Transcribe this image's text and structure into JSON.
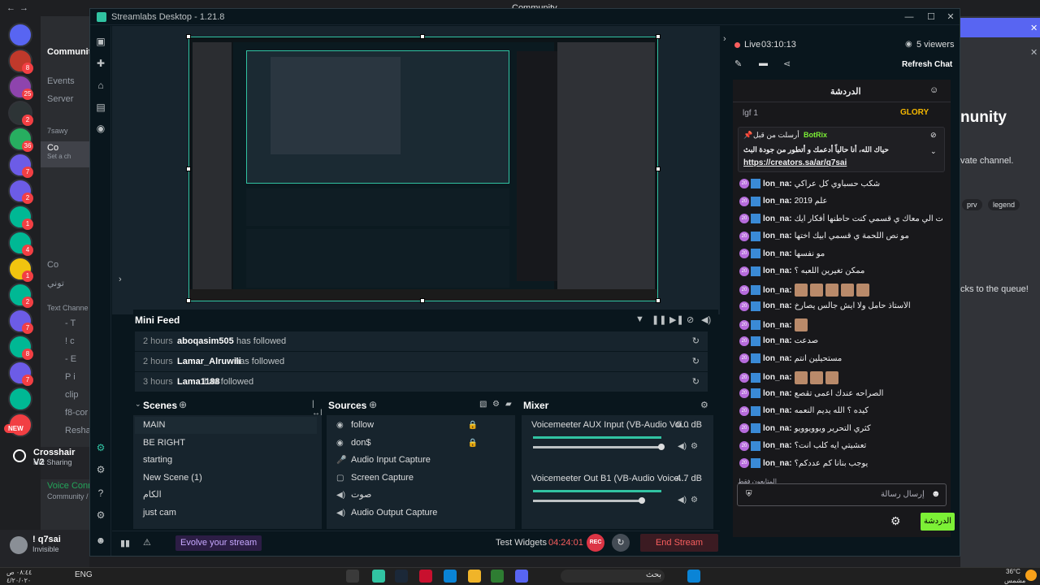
{
  "window": {
    "title": "Streamlabs Desktop - 1.21.8"
  },
  "discord": {
    "top_title": "Community",
    "header": "Communit",
    "events": "Events",
    "server": "Server",
    "category": "7sawy",
    "channel_active": "Co",
    "channel_sub": "Set a ch",
    "channel_2": "Co",
    "channel_3": "توني",
    "text_channels": "Text Channe",
    "text_items": [
      "- T",
      "! c",
      "- E",
      "P i",
      "clip",
      "f8-cor",
      "Reshac"
    ],
    "user_name": "Crosshair V2",
    "user_status": "Not Sharing",
    "voice_label": "Voice Connect",
    "voice_sub": "Community /",
    "account_name": "! q7sai",
    "account_status": "Invisible",
    "right_heading": "nunity",
    "right_text_1": "vate channel.",
    "right_tag_1": "prv",
    "right_tag_2": "legend",
    "right_text_2": "cks to the queue!",
    "new_badge": "NEW",
    "server_badges": [
      "8",
      "25",
      "2",
      "36",
      "7",
      "2",
      "1",
      "4",
      "1",
      "2",
      "7",
      "8",
      "7"
    ]
  },
  "sidenav": {
    "icons": [
      "studio-icon",
      "themes-icon",
      "store-icon",
      "layout-icon",
      "record-icon",
      "highlighter-icon",
      "settings-icon",
      "help-icon",
      "profile-icon"
    ]
  },
  "minifeed": {
    "title": "Mini Feed",
    "events": [
      {
        "time": "2 hours",
        "name": "aboqasim505",
        "action": "has followed"
      },
      {
        "time": "2 hours",
        "name": "Lamar_Alruwili",
        "action": "has followed"
      },
      {
        "time": "3 hours",
        "name": "Lama1188",
        "action": "has followed"
      }
    ]
  },
  "scenes": {
    "title": "Scenes",
    "items": [
      "MAIN",
      "BE RIGHT",
      "starting",
      "New Scene (1)",
      "الكام",
      "just cam"
    ],
    "selected": "MAIN"
  },
  "sources": {
    "title": "Sources",
    "items": [
      {
        "label": "follow",
        "locked": true
      },
      {
        "label": "don$",
        "locked": true
      },
      {
        "label": "Audio Input Capture",
        "locked": false
      },
      {
        "label": "Screen Capture",
        "locked": false
      },
      {
        "label": "صوت",
        "locked": false
      },
      {
        "label": "Audio Output Capture",
        "locked": false
      }
    ]
  },
  "mixer": {
    "title": "Mixer",
    "channels": [
      {
        "name": "Voicemeeter AUX Input (VB-Audio Voi...",
        "db": "0.0 dB",
        "level": 1.0
      },
      {
        "name": "Voicemeeter Out B1 (VB-Audio Voice...",
        "db": "-4.7 dB",
        "level": 0.85
      }
    ]
  },
  "footer": {
    "evolve": "Evolve your stream",
    "test_widgets": "Test Widgets",
    "timer": "04:24:01",
    "rec": "REC",
    "end_stream": "End Stream"
  },
  "live": {
    "status": "Live",
    "time": "03:10:13",
    "viewers": "5 viewers",
    "refresh": "Refresh Chat"
  },
  "chat": {
    "header": "الدردشة",
    "top_user": "GLORY",
    "top_prefix": "lgf 1",
    "pinned_label": "أرسلت من قبل",
    "pinned_user": "BotRix",
    "pinned_text": "حياك الله، أنا حالياً أدعمك و أتطور من جودة البث",
    "pinned_link": "https://creators.sa/ar/q7sai",
    "messages": [
      {
        "user": "lon_na:",
        "text": "شكب حسباوي كل عراكي",
        "emotes": 0
      },
      {
        "user": "lon_na:",
        "text": "علم 2019",
        "emotes": 0
      },
      {
        "user": "lon_na:",
        "text": "البنت الي معاك ي قسمي كنت حاطنها أفكار ايك",
        "emotes": 0
      },
      {
        "user": "lon_na:",
        "text": "مو نص اللحمة ي قسمي ابيك اختها",
        "emotes": 0
      },
      {
        "user": "lon_na:",
        "text": "مو نفسها",
        "emotes": 0
      },
      {
        "user": "lon_na:",
        "text": "ممكن تغيرين اللعبه ؟",
        "emotes": 0
      },
      {
        "user": "lon_na:",
        "text": "",
        "emotes": 5
      },
      {
        "user": "lon_na:",
        "text": "الأستاذ حامل ولا ايش جالس يصارخ",
        "emotes": 0
      },
      {
        "user": "lon_na:",
        "text": "",
        "emotes": 1
      },
      {
        "user": "lon_na:",
        "text": "صدعت",
        "emotes": 0
      },
      {
        "user": "lon_na:",
        "text": "مستحيلين انتم",
        "emotes": 0
      },
      {
        "user": "lon_na:",
        "text": "",
        "emotes": 3
      },
      {
        "user": "lon_na:",
        "text": "الصراحه عندك اعمى تقصع",
        "emotes": 0
      },
      {
        "user": "lon_na:",
        "text": "كيده ؟ الله يديم النعمه",
        "emotes": 0
      },
      {
        "user": "lon_na:",
        "text": "كثري التحرير ويوويوويو",
        "emotes": 0
      },
      {
        "user": "lon_na:",
        "text": "تعشيتي ايه كلب انت؟",
        "emotes": 0
      },
      {
        "user": "lon_na:",
        "text": "يوجب بنانا كم عددكم؟",
        "emotes": 0
      }
    ],
    "followers_only": "المتابعون فقط",
    "input_placeholder": "إرسال رسالة",
    "send": "الدردشة"
  },
  "taskbar": {
    "time": "٠٨:٤٤ ص",
    "date": "٤/٢٠/٠٢٠",
    "lang": "ENG",
    "search": "بحث",
    "weather_temp": "36°C",
    "weather_desc": "مشمس"
  },
  "colors": {
    "accent": "#31c3a2",
    "live": "#f85e5e",
    "chat_send": "#7cf036",
    "discord_brand": "#5865f2"
  }
}
